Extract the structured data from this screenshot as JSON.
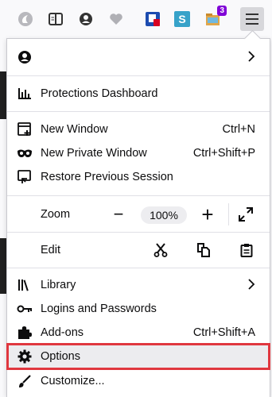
{
  "toolbar": {
    "extension_icons": [
      "sync-icon",
      "reader-view-icon",
      "account-icon",
      "pocket-icon",
      "notifier-icon",
      "stylus-icon",
      "extension-stack-icon"
    ],
    "badge_count": "3",
    "menu_button_icon": "hamburger-menu-icon"
  },
  "menu": {
    "account_icon": "account-icon",
    "protections": "Protections Dashboard",
    "new_window": {
      "label": "New Window",
      "shortcut": "Ctrl+N"
    },
    "private_window": {
      "label": "New Private Window",
      "shortcut": "Ctrl+Shift+P"
    },
    "restore": "Restore Previous Session",
    "zoom": {
      "label": "Zoom",
      "value": "100%",
      "minus": "−",
      "plus": "+"
    },
    "edit": {
      "label": "Edit"
    },
    "library": "Library",
    "logins": "Logins and Passwords",
    "addons": {
      "label": "Add-ons",
      "shortcut": "Ctrl+Shift+A"
    },
    "options": "Options",
    "customize": "Customize..."
  },
  "colors": {
    "highlight_border": "#e0373f",
    "badge": "#8000d7"
  }
}
